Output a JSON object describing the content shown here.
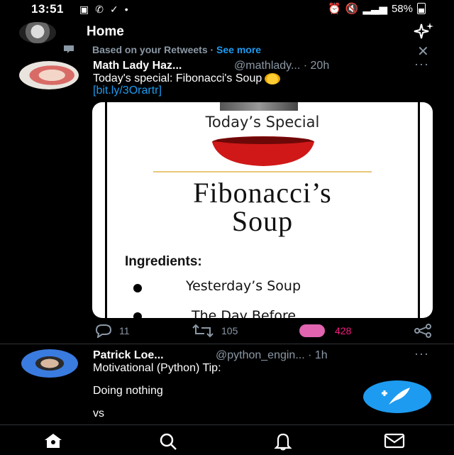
{
  "status_bar": {
    "time": "13:51",
    "battery": "58%",
    "left_icons": [
      "gallery-icon",
      "whatsapp-icon",
      "check-icon",
      "dot-icon"
    ],
    "right_icons": [
      "alarm-icon",
      "mute-icon",
      "signal-icon",
      "battery-icon"
    ]
  },
  "header": {
    "title": "Home",
    "sparkle_icon": "sparkle-icon"
  },
  "context": {
    "text": "Based on your Retweets · ",
    "see_more": "See more",
    "dismiss": "✕"
  },
  "tweet1": {
    "name": "Math Lady Haz...",
    "handle": "@mathlady... · 20h",
    "more": "···",
    "text": "Today's special: Fibonacci's Soup",
    "link": "[bit.ly/3Orartr]",
    "card": {
      "subtitle": "Today’s Special",
      "title_line1": "Fibonacci’s",
      "title_line2": "Soup",
      "ingredients_label": "Ingredients:",
      "item1": "Yesterday’s Soup",
      "item2": "The Day Before"
    },
    "replies": "11",
    "retweets": "105",
    "likes": "428",
    "like_color": "#f91880"
  },
  "tweet2": {
    "name": "Patrick Loe...",
    "handle": "@python_engin... · 1h",
    "more": "···",
    "line1": "Motivational (Python) Tip:",
    "line2": "Doing nothing",
    "line3": "vs"
  },
  "colors": {
    "accent": "#1d9bf0",
    "muted": "#8b98a5",
    "background": "#000000"
  },
  "bottom_nav": [
    "home-icon",
    "search-icon",
    "notifications-icon",
    "messages-icon"
  ]
}
